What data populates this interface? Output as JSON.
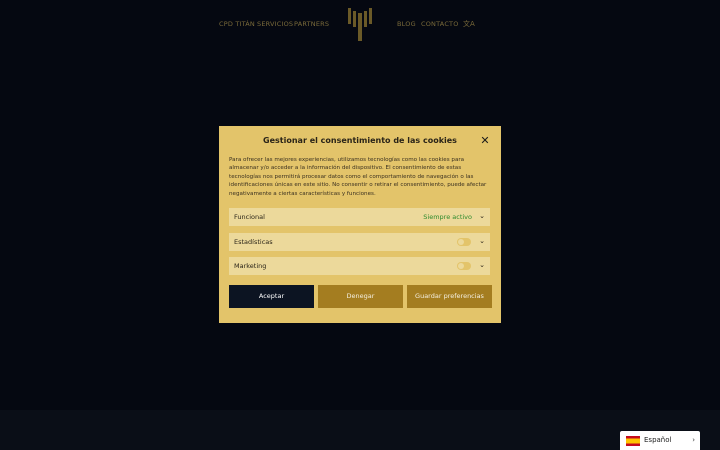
{
  "nav": {
    "items_left": [
      "CPD TITÁN",
      "SERVICIOS",
      "PARTNERS"
    ],
    "items_right": [
      "BLOG",
      "CONTACTO"
    ],
    "language_icon": "translate-icon"
  },
  "cookie_modal": {
    "title": "Gestionar el consentimiento de las cookies",
    "description": "Para ofrecer las mejores experiencias, utilizamos tecnologías como las cookies para almacenar y/o acceder a la información del dispositivo. El consentimiento de estas tecnologías nos permitirá procesar datos como el comportamiento de navegación o las identificaciones únicas en este sitio. No consentir o retirar el consentimiento, puede afectar negativamente a ciertas características y funciones.",
    "categories": [
      {
        "label": "Funcional",
        "status": "Siempre activo"
      },
      {
        "label": "Estadísticas",
        "enabled": false
      },
      {
        "label": "Marketing",
        "enabled": false
      }
    ],
    "buttons": {
      "accept": "Aceptar",
      "deny": "Denegar",
      "save": "Guardar preferencias"
    }
  },
  "language_switcher": {
    "label": "Español"
  },
  "colors": {
    "background": "#050811",
    "modal": "#e3c46a",
    "accent_gold": "#a47d20",
    "primary_button": "#0c1422",
    "active_green": "#2e8b2e"
  }
}
